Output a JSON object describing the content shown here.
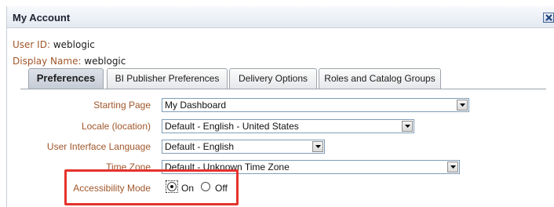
{
  "dialog": {
    "title": "My Account",
    "close_icon": "close-icon"
  },
  "user": {
    "id_label": "User ID:",
    "id_value": "weblogic",
    "display_label": "Display Name:",
    "display_value": "weblogic"
  },
  "tabs": [
    {
      "label": "Preferences",
      "active": true
    },
    {
      "label": "BI Publisher Preferences",
      "active": false
    },
    {
      "label": "Delivery Options",
      "active": false
    },
    {
      "label": "Roles and Catalog Groups",
      "active": false
    }
  ],
  "preferences": {
    "starting_page": {
      "label": "Starting Page",
      "value": "My Dashboard"
    },
    "locale": {
      "label": "Locale (location)",
      "value": "Default - English - United States"
    },
    "ui_language": {
      "label": "User Interface Language",
      "value": "Default - English"
    },
    "time_zone": {
      "label": "Time Zone",
      "value": "Default - Unknown Time Zone"
    },
    "accessibility": {
      "label": "Accessibility Mode",
      "on_label": "On",
      "off_label": "Off",
      "selected": "On"
    }
  },
  "annotation": {
    "color": "#e5322d"
  }
}
